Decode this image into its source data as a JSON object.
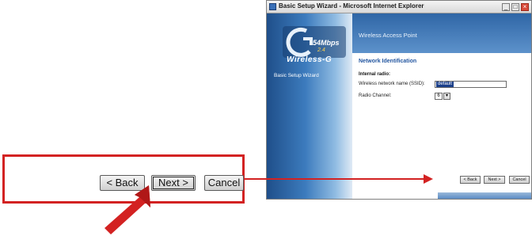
{
  "callout": {
    "back_label": "< Back",
    "next_label": "Next >",
    "cancel_label": "Cancel"
  },
  "window": {
    "title": "Basic Setup Wizard - Microsoft Internet Explorer",
    "controls": {
      "minimize": "_",
      "maximize": "□",
      "close": "×"
    }
  },
  "brand": {
    "speed": "54Mbps",
    "band": "2.4",
    "product": "Wireless-G"
  },
  "sidebar": {
    "items": [
      {
        "label": "Basic Setup Wizard"
      }
    ]
  },
  "header": {
    "title": "Wireless Access Point"
  },
  "form": {
    "section_title": "Network Identification",
    "subsection_title": "Internal radio:",
    "ssid_label": "Wireless network name (SSID):",
    "ssid_value": "default",
    "channel_label": "Radio Channel:",
    "channel_value": "6"
  },
  "wizard_buttons": {
    "back_label": "< Back",
    "next_label": "Next >",
    "cancel_label": "Cancel"
  },
  "colors": {
    "callout_red": "#d32222",
    "brand_blue": "#2f66a6",
    "section_title_blue": "#2356a0"
  },
  "icons": [
    "window-app-icon",
    "minimize-icon",
    "maximize-icon",
    "close-icon",
    "chevron-down-icon",
    "wireless-g-logo"
  ]
}
